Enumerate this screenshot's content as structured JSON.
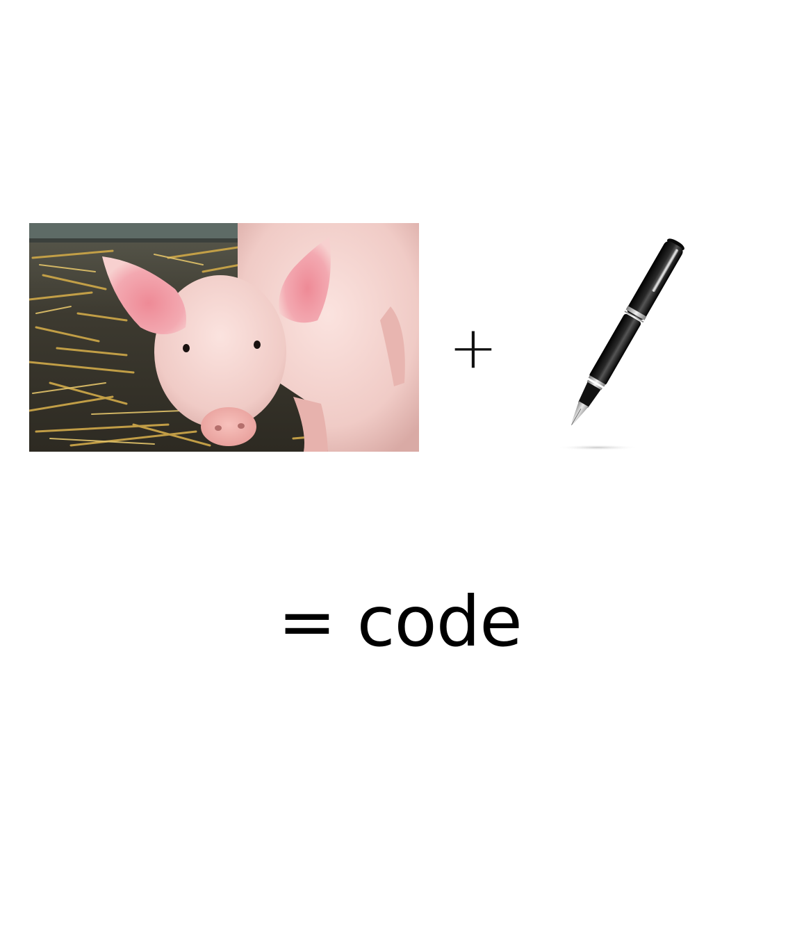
{
  "equation": {
    "operand_one_image": "pig-photo",
    "operator_plus": "+",
    "operand_two_image": "fountain-pen-image",
    "result_text": "= code"
  },
  "colors": {
    "background": "#ffffff",
    "text": "#000000",
    "pig_skin": "#f2c9c4",
    "pig_ear": "#f0a0a8",
    "straw": "#c8a040",
    "floor": "#3e3a2e",
    "pen_body": "#0d0d0d",
    "pen_trim": "#c8c8c8"
  }
}
